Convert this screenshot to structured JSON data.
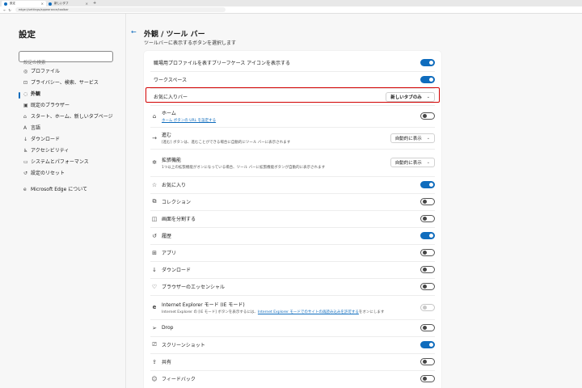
{
  "browser": {
    "tabs": [
      {
        "label": "設定",
        "icon": "gear-icon"
      },
      {
        "label": "新しいタブ",
        "icon": "edge-icon"
      }
    ],
    "new_tab_symbol": "+",
    "url": "edge://settings/appearance/toolbar"
  },
  "sidebar": {
    "title": "設定",
    "search_placeholder": "設定の検索",
    "items": [
      {
        "label": "プロファイル",
        "icon": "profile-icon",
        "glyph": "◎"
      },
      {
        "label": "プライバシー、検索、サービス",
        "icon": "lock-icon",
        "glyph": "⊡"
      },
      {
        "label": "外観",
        "icon": "palette-icon",
        "glyph": "◌",
        "active": true
      },
      {
        "label": "既定のブラウザー",
        "icon": "browser-icon",
        "glyph": "▣"
      },
      {
        "label": "スタート、ホーム、新しいタブページ",
        "icon": "home-icon",
        "glyph": "⌂"
      },
      {
        "label": "言語",
        "icon": "language-icon",
        "glyph": "A"
      },
      {
        "label": "ダウンロード",
        "icon": "download-icon",
        "glyph": "↓"
      },
      {
        "label": "アクセシビリティ",
        "icon": "accessibility-icon",
        "glyph": "♿"
      },
      {
        "label": "システムとパフォーマンス",
        "icon": "system-icon",
        "glyph": "▭"
      },
      {
        "label": "設定のリセット",
        "icon": "reset-icon",
        "glyph": "↺"
      },
      {
        "label": "Microsoft Edge について",
        "icon": "edge-icon",
        "glyph": "e"
      }
    ]
  },
  "main": {
    "back_icon": "back-arrow-icon",
    "title": "外観 / ツール バー",
    "subtitle": "ツールバーに表示するボタンを選択します",
    "rows": [
      {
        "label": "職場用プロファイルを表すブリーフケース アイコンを表示する",
        "toggle": "on"
      },
      {
        "label": "ワークスペース",
        "toggle": "on"
      },
      {
        "label": "お気に入りバー",
        "dropdown": "新しいタブのみ"
      },
      {
        "label": "ホーム",
        "icon": "home-icon",
        "glyph": "⌂",
        "link": "ホーム ボタンの URL を設定する",
        "toggle": "off"
      },
      {
        "label": "進む",
        "icon": "forward-icon",
        "glyph": "→",
        "desc": "[進む] ボタンは、進むことができる場合に自動的にツール バーに表示されます",
        "dropdown": "自動的に表示"
      },
      {
        "label": "拡張機能",
        "icon": "extensions-icon",
        "glyph": "✲",
        "desc": "1つ以上の拡張機能がオンになっている場合、ツール バーに拡張機能ボタンが自動的に表示されます",
        "dropdown": "自動的に表示"
      },
      {
        "label": "お気に入り",
        "icon": "favorites-icon",
        "glyph": "☆",
        "toggle": "on"
      },
      {
        "label": "コレクション",
        "icon": "collections-icon",
        "glyph": "⧉",
        "toggle": "off"
      },
      {
        "label": "画面を分割する",
        "icon": "split-screen-icon",
        "glyph": "◫",
        "toggle": "off"
      },
      {
        "label": "履歴",
        "icon": "history-icon",
        "glyph": "↺",
        "toggle": "on"
      },
      {
        "label": "アプリ",
        "icon": "apps-icon",
        "glyph": "⊞",
        "toggle": "off"
      },
      {
        "label": "ダウンロード",
        "icon": "download-icon",
        "glyph": "↓",
        "toggle": "off"
      },
      {
        "label": "ブラウザーのエッセンシャル",
        "icon": "heart-icon",
        "glyph": "♡",
        "toggle": "off"
      },
      {
        "label": "Internet Explorer モード (IE モード)",
        "icon": "ie-icon",
        "glyph": "e",
        "desc_pre": "Internet Explorer の [IE モード] ボタンを表示するには、",
        "desc_link": "Internet Explorer モードでのサイトの再読み込みを許可する",
        "desc_post": "をオンにします",
        "toggle": "disabled"
      },
      {
        "label": "Drop",
        "icon": "send-icon",
        "glyph": "➢",
        "toggle": "off"
      },
      {
        "label": "スクリーンショット",
        "icon": "screenshot-icon",
        "glyph": "⎚",
        "toggle": "on"
      },
      {
        "label": "共有",
        "icon": "share-icon",
        "glyph": "⇪",
        "toggle": "off"
      },
      {
        "label": "フィードバック",
        "icon": "feedback-icon",
        "glyph": "☺",
        "toggle": "off"
      }
    ]
  },
  "colors": {
    "accent": "#0f6cbd",
    "highlight_border": "#d20000"
  }
}
